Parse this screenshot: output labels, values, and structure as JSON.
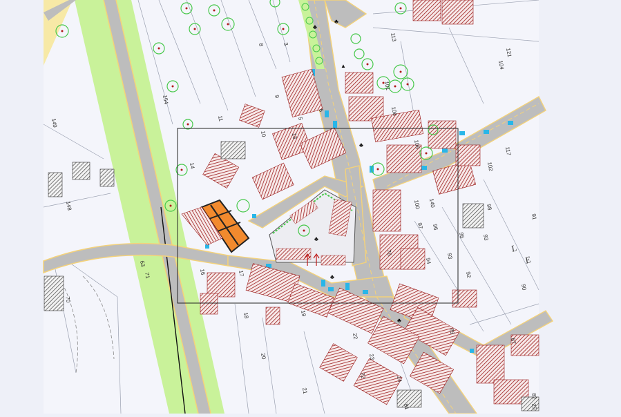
{
  "colors": {
    "background": "#eef0f8",
    "map_paper": "#f4f5fb",
    "road_fill": "#bdbdbd",
    "road_edge": "#f4d27a",
    "green_strip": "#c9f29a",
    "sand_area": "#f7e9a6",
    "building_hatch": "#9b1b1b",
    "highlight_building": "#f28a2e",
    "tree_ring": "#46c84a",
    "tree_dot": "#b01818",
    "crossing": "#29b6e8"
  },
  "map": {
    "parcel_numbers": [
      "149",
      "148",
      "154",
      "11",
      "10",
      "14",
      "8",
      "3",
      "5",
      "6",
      "113",
      "121",
      "104",
      "101",
      "106",
      "105",
      "102",
      "117",
      "140",
      "100",
      "97",
      "96",
      "95",
      "98",
      "93",
      "94",
      "92",
      "90",
      "89",
      "87",
      "91",
      "93",
      "17",
      "18",
      "19",
      "20",
      "21",
      "22",
      "23",
      "22",
      "24",
      "25",
      "13",
      "9",
      "16",
      "70",
      "76",
      "63",
      "71",
      "81",
      "82"
    ],
    "street_letters": [
      "L",
      "E"
    ],
    "focus_frame_label": ""
  }
}
